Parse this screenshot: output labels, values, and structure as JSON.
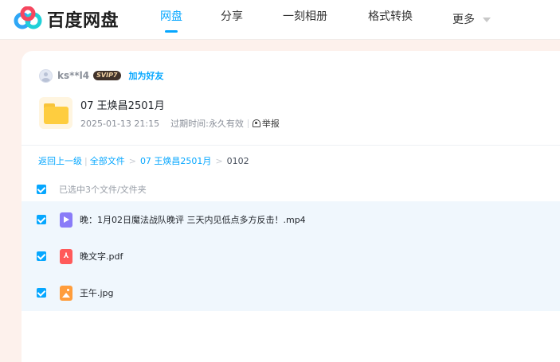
{
  "header": {
    "logo_text": "百度网盘",
    "nav": [
      {
        "label": "网盘",
        "active": true
      },
      {
        "label": "分享",
        "active": false
      },
      {
        "label": "一刻相册",
        "active": false
      },
      {
        "label": "格式转换",
        "active": false
      },
      {
        "label": "更多",
        "active": false
      }
    ]
  },
  "share": {
    "username": "ks**l4",
    "vip_badge": "SVIP7",
    "add_friend": "加为好友",
    "folder_title": "07 王焕昌2501月",
    "date": "2025-01-13 21:15",
    "expiry_label": "过期时间:",
    "expiry_value": "永久有效",
    "report": "举报"
  },
  "breadcrumb": {
    "back": "返回上一级",
    "all_files": "全部文件",
    "folder": "07 王焕昌2501月",
    "current": "0102"
  },
  "selection": {
    "text": "已选中3个文件/文件夹"
  },
  "files": [
    {
      "name": "晚：1月02日魔法战队晚评 三天内见低点多方反击！.mp4",
      "type": "video-icon",
      "checked": true
    },
    {
      "name": "晚文字.pdf",
      "type": "pdf-icon",
      "checked": true
    },
    {
      "name": "王午.jpg",
      "type": "image-icon",
      "checked": true
    }
  ],
  "colors": {
    "accent": "#06a7ff",
    "page_bg": "#fdf1ec",
    "row_bg": "#f0f7fd",
    "folder": "#fecd3f"
  }
}
